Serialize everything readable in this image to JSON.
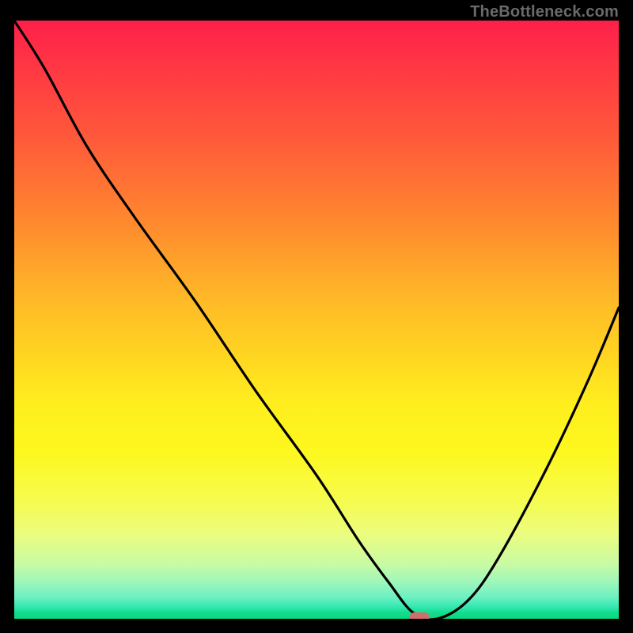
{
  "watermark": "TheBottleneck.com",
  "colors": {
    "frame_bg": "#000000",
    "watermark": "#6a6a6a",
    "curve": "#000000",
    "marker": "#cf6e6d"
  },
  "chart_data": {
    "type": "line",
    "title": "",
    "xlabel": "",
    "ylabel": "",
    "xlim": [
      0,
      100
    ],
    "ylim": [
      0,
      100
    ],
    "series": [
      {
        "name": "bottleneck-curve",
        "x": [
          0,
          5,
          12,
          20,
          30,
          40,
          50,
          57,
          62,
          66,
          70,
          75,
          80,
          88,
          95,
          100
        ],
        "values": [
          100,
          92,
          79,
          67,
          53,
          38,
          24,
          13,
          6,
          1,
          0,
          3,
          10,
          25,
          40,
          52
        ]
      }
    ],
    "marker": {
      "x": 67,
      "y": 0
    },
    "gradient_stops": [
      {
        "pos": 0,
        "color": "#ff1f4a"
      },
      {
        "pos": 0.5,
        "color": "#ffd521"
      },
      {
        "pos": 0.95,
        "color": "#6af0c2"
      },
      {
        "pos": 1.0,
        "color": "#0ad97f"
      }
    ]
  }
}
